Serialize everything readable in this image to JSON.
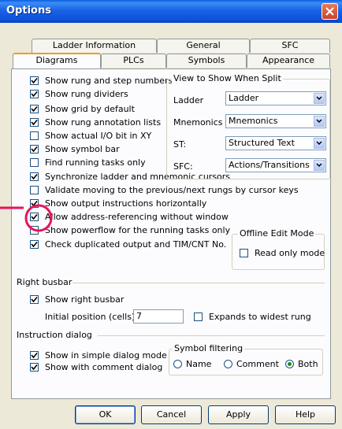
{
  "window": {
    "title": "Options"
  },
  "tabs_back": [
    {
      "label": "Ladder Information"
    },
    {
      "label": "General"
    },
    {
      "label": "SFC"
    }
  ],
  "tabs_front": [
    {
      "label": "Diagrams"
    },
    {
      "label": "PLCs"
    },
    {
      "label": "Symbols"
    },
    {
      "label": "Appearance"
    }
  ],
  "checkboxes": [
    {
      "label": "Show rung and step numbers",
      "checked": true
    },
    {
      "label": "Show rung dividers",
      "checked": true
    },
    {
      "label": "Show grid by default",
      "checked": true
    },
    {
      "label": "Show rung annotation lists",
      "checked": true
    },
    {
      "label": "Show actual I/O bit in XY",
      "checked": false
    },
    {
      "label": "Show symbol bar",
      "checked": true
    },
    {
      "label": "Find running tasks only",
      "checked": false
    },
    {
      "label": "Synchronize ladder and mnemonic cursors",
      "checked": true
    },
    {
      "label": "Validate moving to the previous/next rungs by cursor keys",
      "checked": false
    },
    {
      "label": "Show output instructions horizontally",
      "checked": true
    },
    {
      "label": "Allow address-referencing without window",
      "checked": true
    },
    {
      "label": "Show powerflow for the running tasks only",
      "checked": false
    },
    {
      "label": "Check duplicated output and TIM/CNT No.",
      "checked": true
    }
  ],
  "split_view": {
    "legend": "View to Show When Split",
    "rows": [
      {
        "label": "Ladder",
        "value": "Ladder"
      },
      {
        "label": "Mnemonics",
        "value": "Mnemonics"
      },
      {
        "label": "ST:",
        "value": "Structured Text"
      },
      {
        "label": "SFC:",
        "value": "Actions/Transitions"
      }
    ]
  },
  "offline": {
    "legend": "Offline Edit Mode",
    "read_only_label": "Read only mode",
    "read_only_checked": false
  },
  "right_busbar": {
    "section_label": "Right busbar",
    "show_label": "Show right busbar",
    "show_checked": true,
    "initial_label": "Initial position (cells):",
    "initial_value": "7",
    "expand_label": "Expands to widest rung",
    "expand_checked": false
  },
  "instruction_dialog": {
    "section_label": "Instruction dialog",
    "simple_label": "Show in simple dialog mode",
    "simple_checked": true,
    "comment_label": "Show with comment dialog",
    "comment_checked": true
  },
  "symbol_filtering": {
    "legend": "Symbol filtering",
    "options": [
      {
        "label": "Name",
        "selected": false
      },
      {
        "label": "Comment",
        "selected": false
      },
      {
        "label": "Both",
        "selected": true
      }
    ]
  },
  "buttons": {
    "ok": "OK",
    "cancel": "Cancel",
    "apply": "Apply",
    "help": "Help"
  },
  "colors": {
    "title_bar": "#0a5ee0",
    "highlight_circle": "#e8125c",
    "dialog_bg": "#ece9d8"
  }
}
